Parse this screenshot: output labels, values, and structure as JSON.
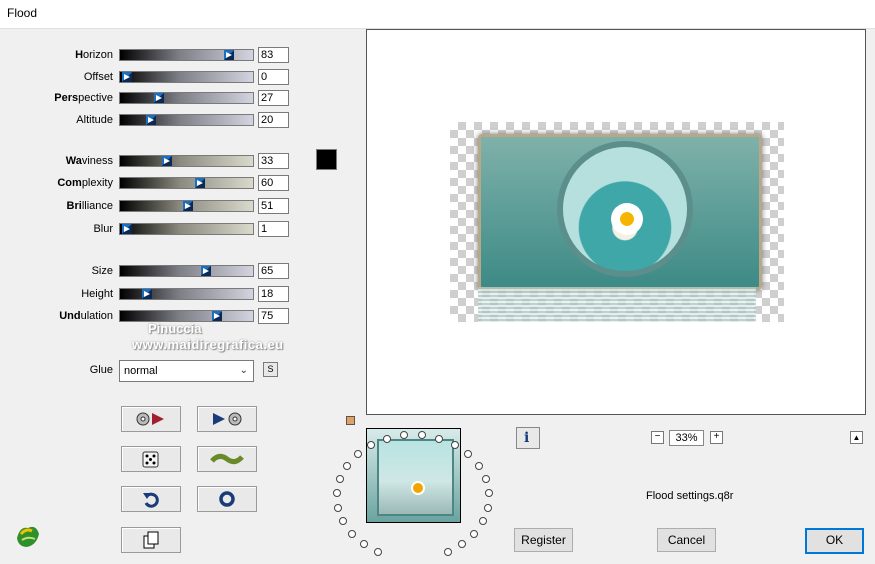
{
  "window": {
    "title": "Flood"
  },
  "params": [
    {
      "label_bold": "H",
      "label_rest": "orizon",
      "value": 83,
      "percent": 82
    },
    {
      "label_bold": "",
      "label_rest": "Offset",
      "value": 0,
      "percent": 5
    },
    {
      "label_bold": "Pers",
      "label_rest": "pective",
      "value": 27,
      "percent": 29
    },
    {
      "label_bold": "",
      "label_rest": "Altitude",
      "value": 20,
      "percent": 23
    },
    {
      "label_bold": "Wa",
      "label_rest": "viness",
      "value": 33,
      "percent": 35
    },
    {
      "label_bold": "Com",
      "label_rest": "plexity",
      "value": 60,
      "percent": 60
    },
    {
      "label_bold": "Bri",
      "label_rest": "lliance",
      "value": 51,
      "percent": 51
    },
    {
      "label_bold": "",
      "label_rest": "Blur",
      "value": 1,
      "percent": 5
    },
    {
      "label_bold": "",
      "label_rest": "Size",
      "value": 65,
      "percent": 65
    },
    {
      "label_bold": "",
      "label_rest": "Height",
      "value": 18,
      "percent": 20
    },
    {
      "label_bold": "Und",
      "label_rest": "ulation",
      "value": 75,
      "percent": 73
    }
  ],
  "flood_color": "#000000",
  "glue": {
    "label": "Glue",
    "value": "normal",
    "s_button": "S"
  },
  "watermark": {
    "line1": "Pinuccia",
    "line2": "www.maidiregrafica.eu"
  },
  "zoom": {
    "value": "33%",
    "minus": "−",
    "plus": "+"
  },
  "info_icon": "i",
  "settings_file": "Flood settings.q8r",
  "buttons": {
    "register": "Register",
    "cancel": "Cancel",
    "ok": "OK"
  }
}
